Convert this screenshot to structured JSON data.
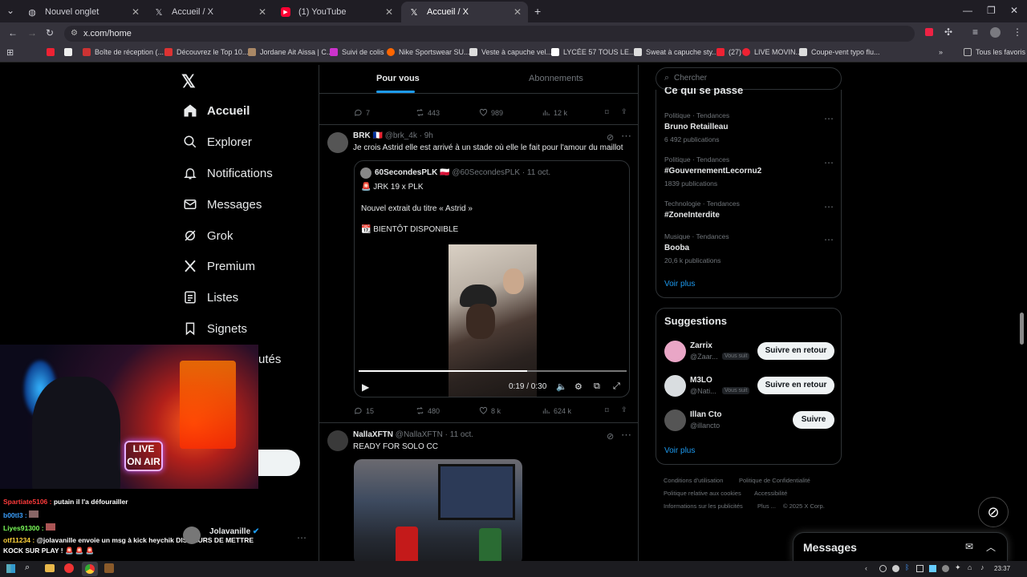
{
  "browser": {
    "tabs": [
      {
        "title": "Nouvel onglet",
        "icon": "globe-icon"
      },
      {
        "title": "Accueil / X",
        "icon": "x-logo-icon"
      },
      {
        "title": "(1) YouTube",
        "icon": "youtube-icon"
      },
      {
        "title": "Accueil / X",
        "icon": "x-logo-icon"
      }
    ],
    "url": "x.com/home",
    "bookmarks": [
      "Boîte de réception (...",
      "Découvrez le Top 10...",
      "Jordane Ait Aissa | C...",
      "Suivi de colis",
      "Nike Sportswear SU...",
      "Veste à capuche vel...",
      "LYCÉE 57 TOUS LE...",
      "Sweat à capuche sty...",
      "(27)",
      "LIVE MOVIN...",
      "Coupe-vent typo flu..."
    ],
    "all_bookmarks": "Tous les favoris"
  },
  "nav": {
    "items": [
      "Accueil",
      "Explorer",
      "Notifications",
      "Messages",
      "Grok",
      "Premium",
      "Listes",
      "Signets"
    ],
    "partial": "utés"
  },
  "feed": {
    "tabs": [
      "Pour vous",
      "Abonnements"
    ],
    "top_actions": {
      "replies": "7",
      "reposts": "443",
      "likes": "989",
      "views": "12 k"
    },
    "post1": {
      "name": "BRK",
      "handle": "@brk_4k",
      "time": "· 9h",
      "text": "Je crois Astrid elle est arrivé à un stade où elle le fait pour l'amour du maillot",
      "quote": {
        "name": "60SecondesPLK",
        "handle": "@60SecondesPLK",
        "time": "· 11 oct.",
        "line1": "JRK 19 x PLK",
        "line2": "Nouvel extrait du titre « Astrid »",
        "line3": "BIENTÔT DISPONIBLE"
      },
      "video_time": "0:19 / 0:30",
      "video_progress": 0.63,
      "actions": {
        "replies": "15",
        "reposts": "480",
        "likes": "8 k",
        "views": "624 k"
      }
    },
    "post2": {
      "name": "NallaXFTN",
      "handle": "@NallaXFTN",
      "time": "· 11 oct.",
      "text": "READY FOR SOLO CC"
    }
  },
  "right": {
    "search_placeholder": "Chercher",
    "trends_title": "Ce qui se passe",
    "trends": [
      {
        "cat": "Politique · Tendances",
        "name": "Bruno Retailleau",
        "count": "6 492 publications"
      },
      {
        "cat": "Politique · Tendances",
        "name": "#GouvernementLecornu2",
        "count": "1839 publications"
      },
      {
        "cat": "Technologie · Tendances",
        "name": "#ZoneInterdite",
        "count": ""
      },
      {
        "cat": "Musique · Tendances",
        "name": "Booba",
        "count": "20,6 k publications"
      }
    ],
    "see_more": "Voir plus",
    "suggestions_title": "Suggestions",
    "suggestions": [
      {
        "name": "Zarrix",
        "handle": "@Zaar...",
        "badge": "Vous suit",
        "button": "Suivre en retour"
      },
      {
        "name": "M3LO",
        "handle": "@Nati...",
        "badge": "Vous suit",
        "button": "Suivre en retour"
      },
      {
        "name": "Illan Cto",
        "handle": "@illancto",
        "badge": "",
        "button": "Suivre"
      }
    ],
    "see_more2": "Voir plus",
    "footer": [
      "Conditions d'utilisation",
      "Politique de Confidentialité",
      "Politique relative aux cookies",
      "Accessibilité",
      "Informations sur les publicités",
      "Plus ...",
      "© 2025 X Corp."
    ],
    "messages": "Messages"
  },
  "stream": {
    "streamer": "Jolavanille",
    "chat": [
      {
        "user": "Spartiate5106 :",
        "msg": "putain il l'a défourailler",
        "color": "#ff3b3b"
      },
      {
        "user": "b00tl3 :",
        "msg": "",
        "color": "#3aa0ff"
      },
      {
        "user": "Liyes91300 :",
        "msg": "",
        "color": "#7cff5a"
      },
      {
        "user": "otf11234 :",
        "msg": "@jolavanille envoie un msg à kick heychik DIS LEURS DE METTRE",
        "color": "#ffd23a"
      },
      {
        "user": "",
        "msg": "KOCK SUR PLAY ! 🚨 🚨 🚨",
        "color": "#fff"
      }
    ]
  },
  "taskbar": {
    "time": "23:37"
  }
}
